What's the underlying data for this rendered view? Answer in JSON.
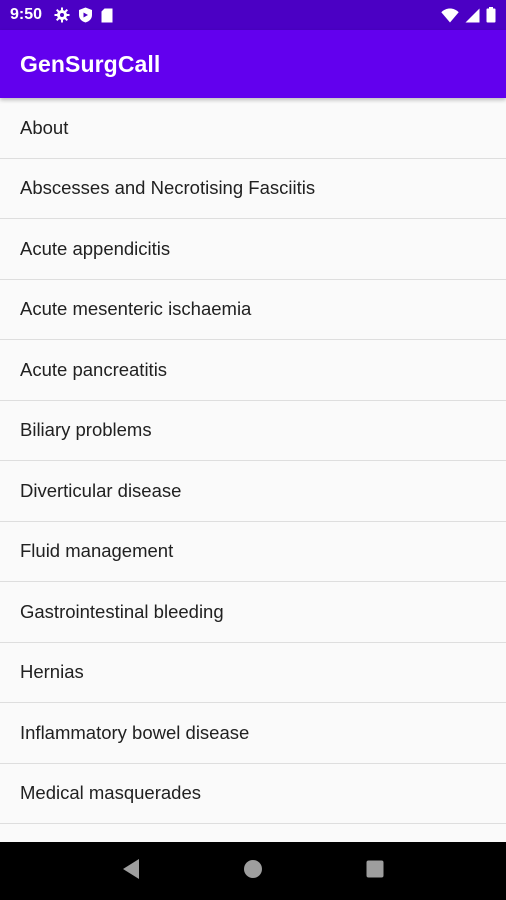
{
  "status_bar": {
    "time": "9:50",
    "left_icons": [
      "gear-icon",
      "shield-icon",
      "sd-card-icon"
    ],
    "right_icons": [
      "wifi-icon",
      "signal-icon",
      "battery-icon"
    ]
  },
  "app_bar": {
    "title": "GenSurgCall",
    "color": "#6200ee"
  },
  "topics": [
    {
      "label": "About"
    },
    {
      "label": "Abscesses and Necrotising Fasciitis"
    },
    {
      "label": "Acute appendicitis"
    },
    {
      "label": "Acute mesenteric ischaemia"
    },
    {
      "label": "Acute pancreatitis"
    },
    {
      "label": "Biliary problems"
    },
    {
      "label": "Diverticular disease"
    },
    {
      "label": "Fluid management"
    },
    {
      "label": "Gastrointestinal bleeding"
    },
    {
      "label": "Hernias"
    },
    {
      "label": "Inflammatory bowel disease"
    },
    {
      "label": "Medical masquerades"
    },
    {
      "label": ""
    }
  ],
  "nav_bar": {
    "buttons": [
      "back-icon",
      "home-icon",
      "recents-icon"
    ]
  }
}
